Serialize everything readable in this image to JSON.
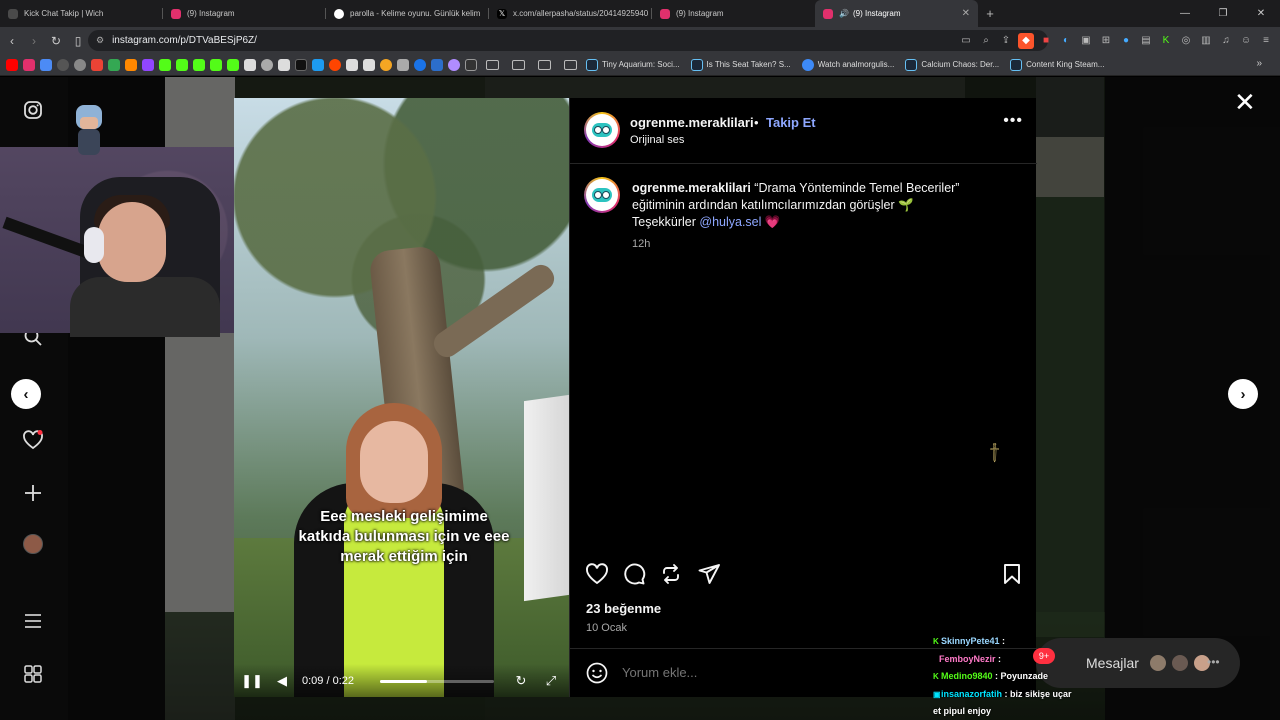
{
  "browser": {
    "tabs": [
      {
        "title": "Kick Chat Takip | Wich",
        "color": "#4a4a4a",
        "active": false
      },
      {
        "title": "(9) Instagram",
        "color": "#e1306c",
        "active": false
      },
      {
        "title": "parolla - Kelime oyunu. Günlük kelim",
        "color": "#ffffff",
        "active": false
      },
      {
        "title": "x.com/allerpasha/status/20414925940",
        "color": "#000000",
        "active": false
      },
      {
        "title": "(9) Instagram",
        "color": "#e1306c",
        "active": false
      },
      {
        "title": "(9) Instagram",
        "color": "#e1306c",
        "active": true
      }
    ],
    "new_tab": "+",
    "url": "instagram.com/p/DTVaBESjP6Z/",
    "bookmarks": [
      {
        "label": "Tiny Aquarium: Soci...",
        "color": "#1b2838"
      },
      {
        "label": "Is This Seat Taken? S...",
        "color": "#1b2838"
      },
      {
        "label": "Watch analmorgulis...",
        "color": "#3d8af7"
      },
      {
        "label": "Calcium Chaos: Der...",
        "color": "#1b2838"
      },
      {
        "label": "Content King Steam...",
        "color": "#1b2838"
      }
    ],
    "bookmark_more": "»"
  },
  "post": {
    "username": "ogrenme.meraklilari",
    "follow_label": "Takip Et",
    "audio_label": "Orijinal ses",
    "caption_quote": "“Drama Yönteminde Temel Beceriler” eğitiminin ardından katılımcılarımızdan görüşler 🌱 Teşekkürler ",
    "mention": "@hulya.sel",
    "heart": "💗",
    "time_ago": "12h",
    "likes": "23 beğenme",
    "date": "10 Ocak",
    "comment_placeholder": "Yorum ekle..."
  },
  "video": {
    "caption": "Eee mesleki gelişimime katkıda bulunması için ve eee merak ettiğim için",
    "current_time": "0:09",
    "duration": "0:22",
    "time_display": "0:09 / 0:22",
    "progress": 0.41
  },
  "chat": {
    "lines": [
      {
        "user": "SkinnyPete41",
        "text": ":",
        "color": "#9ad7ff"
      },
      {
        "user": "FemboyNezir",
        "text": ":",
        "color": "#ff7ac8"
      },
      {
        "user": "Medino9840",
        "text": ": Poyunzade",
        "color": "#53fc18"
      },
      {
        "user": "insanazorfatih",
        "text": ": biz sikişe uçar",
        "color": "#00e5ff"
      },
      {
        "user": "",
        "text": "et pipul enjoy",
        "color": "#ffffff"
      }
    ]
  },
  "messages": {
    "label": "Mesajlar",
    "badge": "9+"
  },
  "colors": {
    "link": "#8ea7ff",
    "panel_bg": "#000000",
    "accent_red": "#ff3040"
  }
}
